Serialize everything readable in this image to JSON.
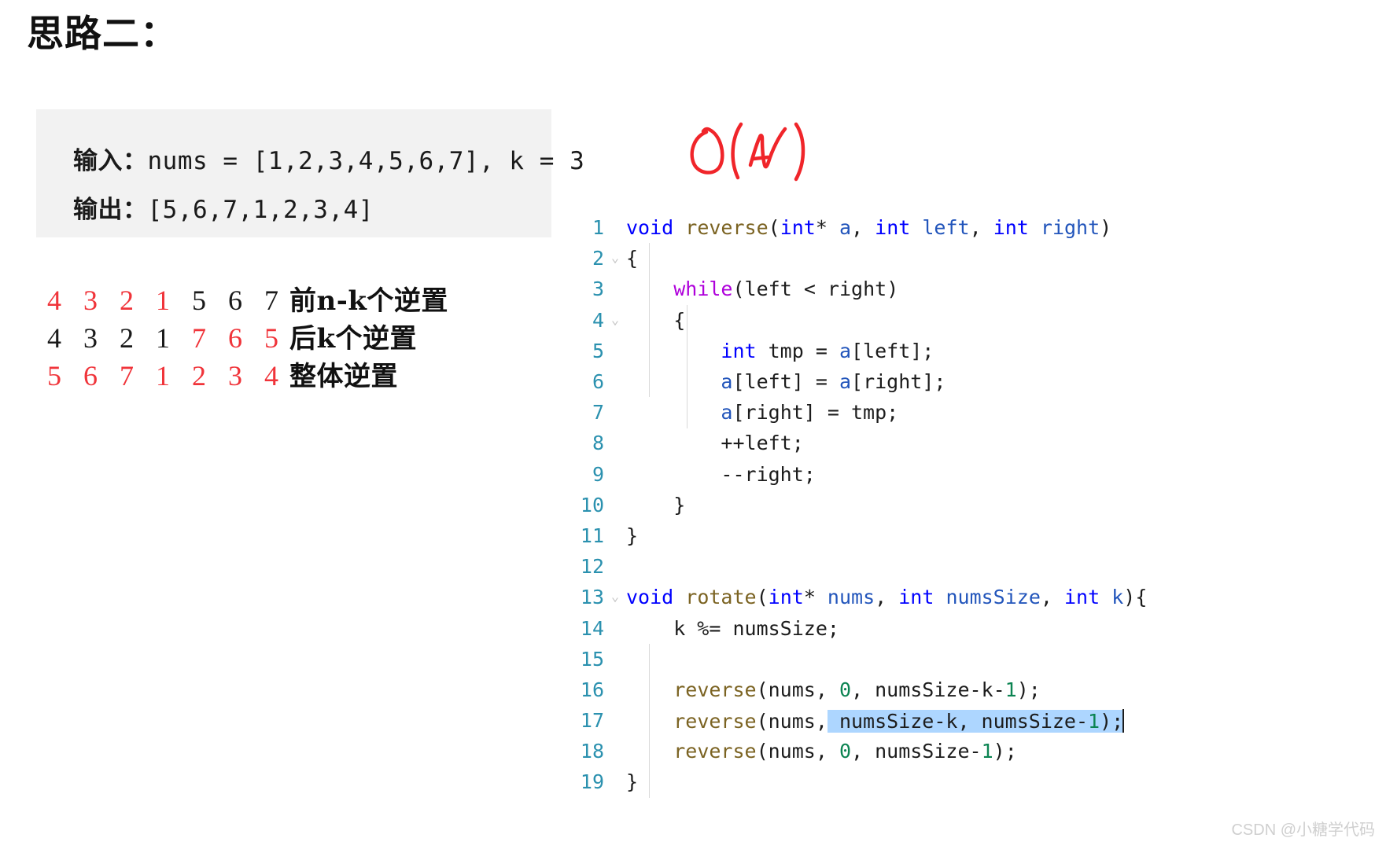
{
  "page": {
    "title": "思路二："
  },
  "quote_block": {
    "input_label": "输入：",
    "input_value": "nums = [1,2,3,4,5,6,7], k = 3",
    "output_label": "输出：",
    "output_value": "[5,6,7,1,2,3,4]"
  },
  "annotation": {
    "text": "O(N)",
    "color": "#f0252a"
  },
  "steps": [
    {
      "digits": [
        "4",
        "3",
        "2",
        "1",
        "5",
        "6",
        "7"
      ],
      "colors": [
        "red",
        "red",
        "red",
        "red",
        "black",
        "black",
        "black"
      ],
      "note": "前n-k个逆置"
    },
    {
      "digits": [
        "4",
        "3",
        "2",
        "1",
        "7",
        "6",
        "5"
      ],
      "colors": [
        "black",
        "black",
        "black",
        "black",
        "red",
        "red",
        "red"
      ],
      "note": "后k个逆置"
    },
    {
      "digits": [
        "5",
        "6",
        "7",
        "1",
        "2",
        "3",
        "4"
      ],
      "colors": [
        "red",
        "red",
        "red",
        "red",
        "red",
        "red",
        "red"
      ],
      "note": "整体逆置"
    }
  ],
  "code": {
    "language": "c",
    "selected_text": "numsSize-k, numsSize-1);",
    "lines": [
      {
        "n": "1",
        "fold": "",
        "text": "void reverse(int* a, int left, int right)"
      },
      {
        "n": "2",
        "fold": "⌄",
        "text": "{"
      },
      {
        "n": "3",
        "fold": "",
        "text": "    while(left < right)"
      },
      {
        "n": "4",
        "fold": "⌄",
        "text": "    {"
      },
      {
        "n": "5",
        "fold": "",
        "text": "        int tmp = a[left];"
      },
      {
        "n": "6",
        "fold": "",
        "text": "        a[left] = a[right];"
      },
      {
        "n": "7",
        "fold": "",
        "text": "        a[right] = tmp;"
      },
      {
        "n": "8",
        "fold": "",
        "text": "        ++left;"
      },
      {
        "n": "9",
        "fold": "",
        "text": "        --right;"
      },
      {
        "n": "10",
        "fold": "",
        "text": "    }"
      },
      {
        "n": "11",
        "fold": "",
        "text": "}"
      },
      {
        "n": "12",
        "fold": "",
        "text": ""
      },
      {
        "n": "13",
        "fold": "⌄",
        "text": "void rotate(int* nums, int numsSize, int k){"
      },
      {
        "n": "14",
        "fold": "",
        "text": "    k %= numsSize;"
      },
      {
        "n": "15",
        "fold": "",
        "text": ""
      },
      {
        "n": "16",
        "fold": "",
        "text": "    reverse(nums, 0, numsSize-k-1);"
      },
      {
        "n": "17",
        "fold": "",
        "text": "    reverse(nums, numsSize-k, numsSize-1);"
      },
      {
        "n": "18",
        "fold": "",
        "text": "    reverse(nums, 0, numsSize-1);"
      },
      {
        "n": "19",
        "fold": "",
        "text": "}"
      }
    ]
  },
  "watermark": {
    "text": "CSDN @小糖学代码"
  }
}
